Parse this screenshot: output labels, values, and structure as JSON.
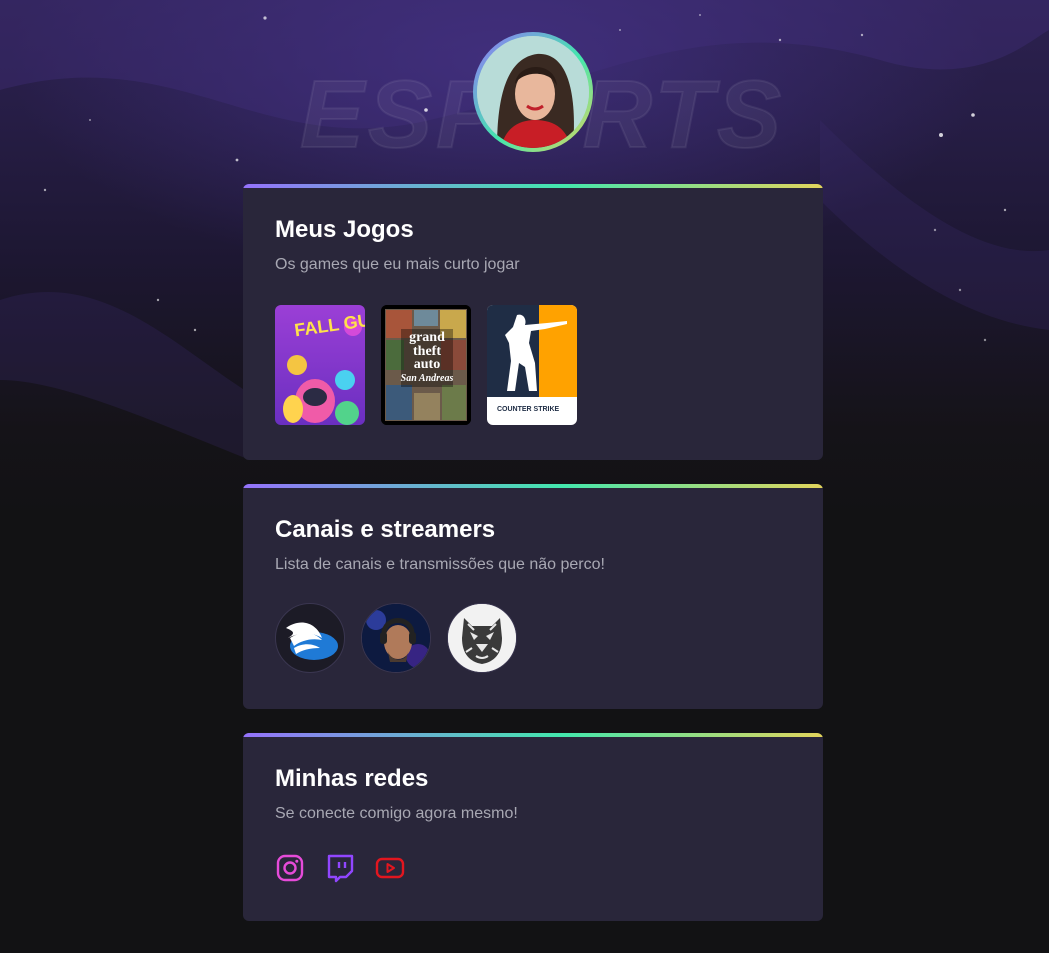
{
  "background": {
    "watermark_text": "ESPORTS"
  },
  "profile": {
    "avatar_icon": "profile-photo-woman-red-shirt"
  },
  "accent_gradient": [
    "#9572fc",
    "#43e7ad",
    "#e2d45c"
  ],
  "sections": {
    "games": {
      "title": "Meus Jogos",
      "subtitle": "Os games que eu mais curto jogar",
      "items": [
        {
          "name": "fall-guys-cover",
          "logo_text": "FALL GUYS"
        },
        {
          "name": "gta-san-andreas-cover",
          "logo_lines": [
            "grand",
            "theft",
            "auto",
            "San Andreas"
          ]
        },
        {
          "name": "counter-strike-cover",
          "logo_text": "COUNTER STRIKE"
        }
      ]
    },
    "channels": {
      "title": "Canais e streamers",
      "subtitle": "Lista de canais e transmissões que não perco!",
      "items": [
        {
          "name": "channel-winged-logo",
          "icon": "winged-shoe-icon"
        },
        {
          "name": "channel-streamer-headset",
          "icon": "streamer-photo"
        },
        {
          "name": "channel-tiger-logo",
          "icon": "tiger-head-icon"
        }
      ]
    },
    "socials": {
      "title": "Minhas redes",
      "subtitle": "Se conecte comigo agora mesmo!",
      "items": [
        {
          "name": "instagram-icon",
          "color": "#e64bd9"
        },
        {
          "name": "twitch-icon",
          "color": "#9146ff"
        },
        {
          "name": "youtube-icon",
          "color": "#e2161f"
        }
      ]
    }
  }
}
